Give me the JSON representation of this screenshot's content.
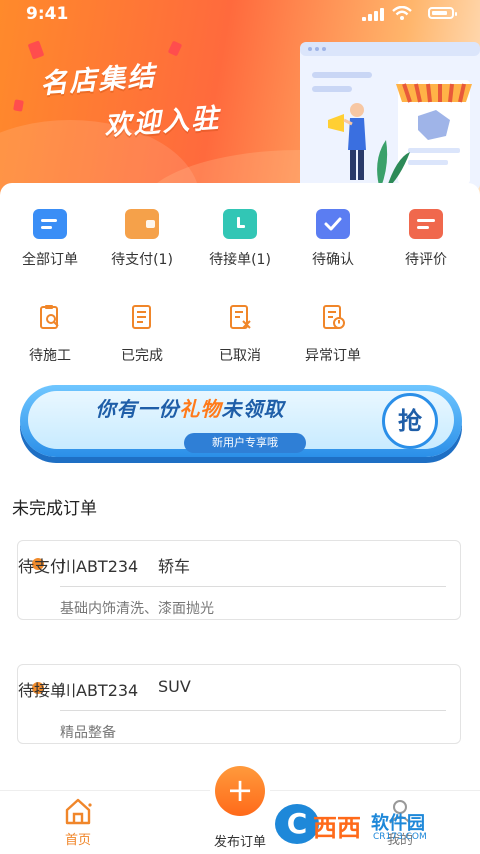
{
  "status_bar": {
    "time": "9:41"
  },
  "banner": {
    "line1": "名店集结",
    "line2": "欢迎入驻"
  },
  "order_grid": [
    {
      "label": "全部订单",
      "icon": "all-orders-icon",
      "color": "#3a8ef6"
    },
    {
      "label": "待支付(1)",
      "icon": "wallet-icon",
      "color": "#f5a14a"
    },
    {
      "label": "待接单(1)",
      "icon": "clock-icon",
      "color": "#32c6b5"
    },
    {
      "label": "待确认",
      "icon": "check-icon",
      "color": "#5b7df2"
    },
    {
      "label": "待评价",
      "icon": "comment-icon",
      "color": "#f0684d"
    }
  ],
  "service_grid": [
    {
      "label": "待施工",
      "icon": "clipboard-search-icon"
    },
    {
      "label": "已完成",
      "icon": "document-icon"
    },
    {
      "label": "已取消",
      "icon": "document-cancel-icon"
    },
    {
      "label": "异常订单",
      "icon": "document-alert-icon"
    }
  ],
  "promo": {
    "text_a": "你有一份",
    "text_hl": "礼物",
    "text_b": "未领取",
    "sub": "新用户专享哦",
    "grab": "抢"
  },
  "section_title": "未完成订单",
  "orders": [
    {
      "plate": "川ABT234",
      "type": "轿车",
      "status": "待支付",
      "desc": "基础内饰清洗、漆面抛光"
    },
    {
      "plate": "川ABT234",
      "type": "SUV",
      "status": "待接单",
      "desc": "精品整备"
    }
  ],
  "tabbar": {
    "home": "首页",
    "publish": "发布订单",
    "publish_icon": "+",
    "mine": "我的"
  },
  "watermark": {
    "brand": "西西",
    "site": "软件园",
    "domain": "CR173.COM"
  },
  "colors": {
    "accent": "#ff7a1a",
    "order_dot": "#f08b2c",
    "promo_blue": "#2b8fe8"
  }
}
